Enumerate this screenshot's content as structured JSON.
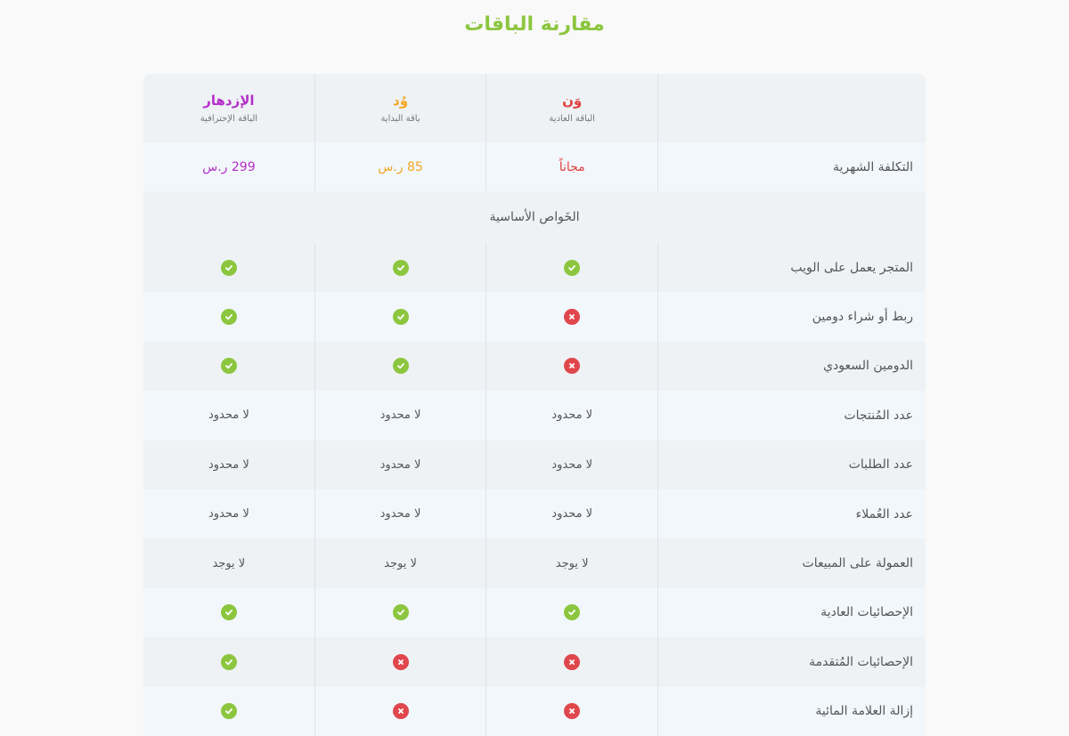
{
  "page": {
    "title": "مقارنة الباقات"
  },
  "plans": [
    {
      "name": "وَن",
      "subtitle": "الباقة العادية",
      "price": "مجاناً",
      "color": "#e0423f"
    },
    {
      "name": "وُد",
      "subtitle": "باقة البداية",
      "price": "85 ر.س",
      "color": "#f5a623"
    },
    {
      "name": "الإزدهار",
      "subtitle": "الباقة الإحترافية",
      "price": "299 ر.س",
      "color": "#b530c9"
    }
  ],
  "price_row": {
    "label": "التكلفة الشهرية"
  },
  "section": {
    "title": "الخَواص الأساسية"
  },
  "features": [
    {
      "label": "المتجر يعمل على الويب",
      "values": [
        "check",
        "check",
        "check"
      ]
    },
    {
      "label": "ربط أو شراء دومين",
      "values": [
        "cross",
        "check",
        "check"
      ]
    },
    {
      "label": "الدومين السعودي",
      "values": [
        "cross",
        "check",
        "check"
      ]
    },
    {
      "label": "عدد المُنتجات",
      "values": [
        "لا محدود",
        "لا محدود",
        "لا محدود"
      ]
    },
    {
      "label": "عدد الطلبات",
      "values": [
        "لا محدود",
        "لا محدود",
        "لا محدود"
      ]
    },
    {
      "label": "عدد العُملاء",
      "values": [
        "لا محدود",
        "لا محدود",
        "لا محدود"
      ]
    },
    {
      "label": "العمولة على المبيعات",
      "values": [
        "لا يوجد",
        "لا يوجد",
        "لا يوجد"
      ]
    },
    {
      "label": "الإحصائيات العادية",
      "values": [
        "check",
        "check",
        "check"
      ]
    },
    {
      "label": "الإحصائيات المُتقدمة",
      "values": [
        "cross",
        "cross",
        "check"
      ]
    },
    {
      "label": "إزالة العلامة المائية",
      "values": [
        "cross",
        "cross",
        "check"
      ]
    }
  ],
  "colors": {
    "accent": "#8cc63f",
    "check": "#8cc63f",
    "cross": "#e0474c"
  }
}
